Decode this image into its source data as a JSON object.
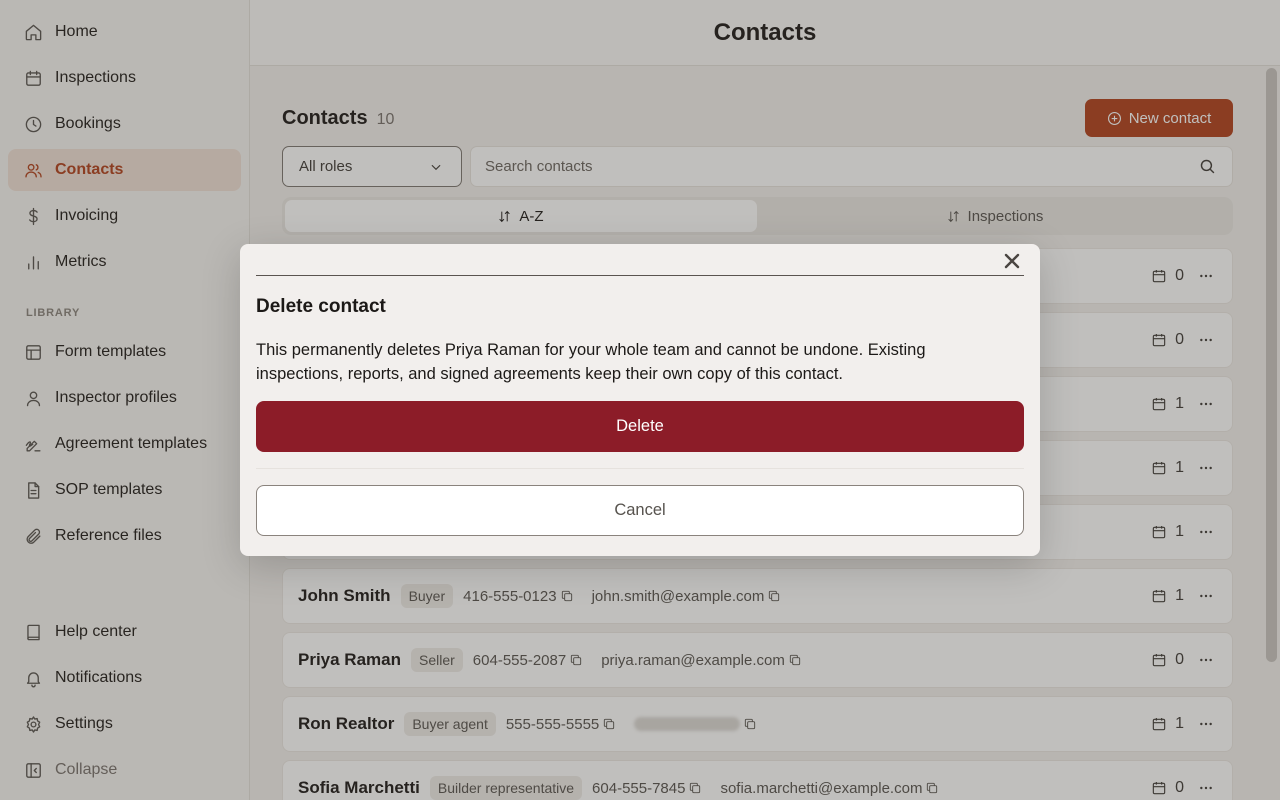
{
  "sidebar": {
    "items": [
      {
        "label": "Home",
        "icon": "home-icon"
      },
      {
        "label": "Inspections",
        "icon": "calendar-icon"
      },
      {
        "label": "Bookings",
        "icon": "clock-icon"
      },
      {
        "label": "Contacts",
        "icon": "users-icon",
        "active": true
      },
      {
        "label": "Invoicing",
        "icon": "dollar-icon"
      },
      {
        "label": "Metrics",
        "icon": "bar-chart-icon"
      }
    ],
    "library_label": "LIBRARY",
    "library_items": [
      {
        "label": "Form templates",
        "icon": "layout-icon"
      },
      {
        "label": "Inspector profiles",
        "icon": "user-icon"
      },
      {
        "label": "Agreement templates",
        "icon": "signature-icon"
      },
      {
        "label": "SOP templates",
        "icon": "document-icon"
      },
      {
        "label": "Reference files",
        "icon": "paperclip-icon"
      }
    ],
    "bottom_items": [
      {
        "label": "Help center",
        "icon": "book-icon"
      },
      {
        "label": "Notifications",
        "icon": "bell-icon"
      },
      {
        "label": "Settings",
        "icon": "gear-icon"
      },
      {
        "label": "Collapse",
        "icon": "sidebar-collapse-icon"
      }
    ]
  },
  "header": {
    "title": "Contacts"
  },
  "main": {
    "title": "Contacts",
    "count": "10",
    "new_button_label": "New contact",
    "role_filter": "All roles",
    "search_placeholder": "Search contacts",
    "sort_tabs": [
      {
        "label": "A-Z",
        "active": true
      },
      {
        "label": "Inspections",
        "active": false
      }
    ],
    "rows": [
      {
        "name": "",
        "role": "",
        "phone": "",
        "email": "",
        "count": "0"
      },
      {
        "name": "",
        "role": "",
        "phone": "",
        "email": "",
        "count": "0"
      },
      {
        "name": "",
        "role": "",
        "phone": "",
        "email": "",
        "count": "1"
      },
      {
        "name": "",
        "role": "",
        "phone": "",
        "email": "",
        "count": "1"
      },
      {
        "name": "",
        "role": "",
        "phone": "",
        "email": "",
        "count": "1"
      },
      {
        "name": "John Smith",
        "role": "Buyer",
        "phone": "416-555-0123",
        "email": "john.smith@example.com",
        "count": "1"
      },
      {
        "name": "Priya Raman",
        "role": "Seller",
        "phone": "604-555-2087",
        "email": "priya.raman@example.com",
        "count": "0"
      },
      {
        "name": "Ron Realtor",
        "role": "Buyer agent",
        "phone": "555-555-5555",
        "email": "",
        "email_hidden": true,
        "count": "1"
      },
      {
        "name": "Sofia Marchetti",
        "role": "Builder representative",
        "phone": "604-555-7845",
        "email": "sofia.marchetti@example.com",
        "count": "0"
      }
    ]
  },
  "modal": {
    "title": "Delete contact",
    "message": "This permanently deletes Priya Raman for your whole team and cannot be undone. Existing inspections, reports, and signed agreements keep their own copy of this contact.",
    "delete_label": "Delete",
    "cancel_label": "Cancel"
  },
  "colors": {
    "accent": "#b1401b",
    "danger": "#8c1c28"
  }
}
